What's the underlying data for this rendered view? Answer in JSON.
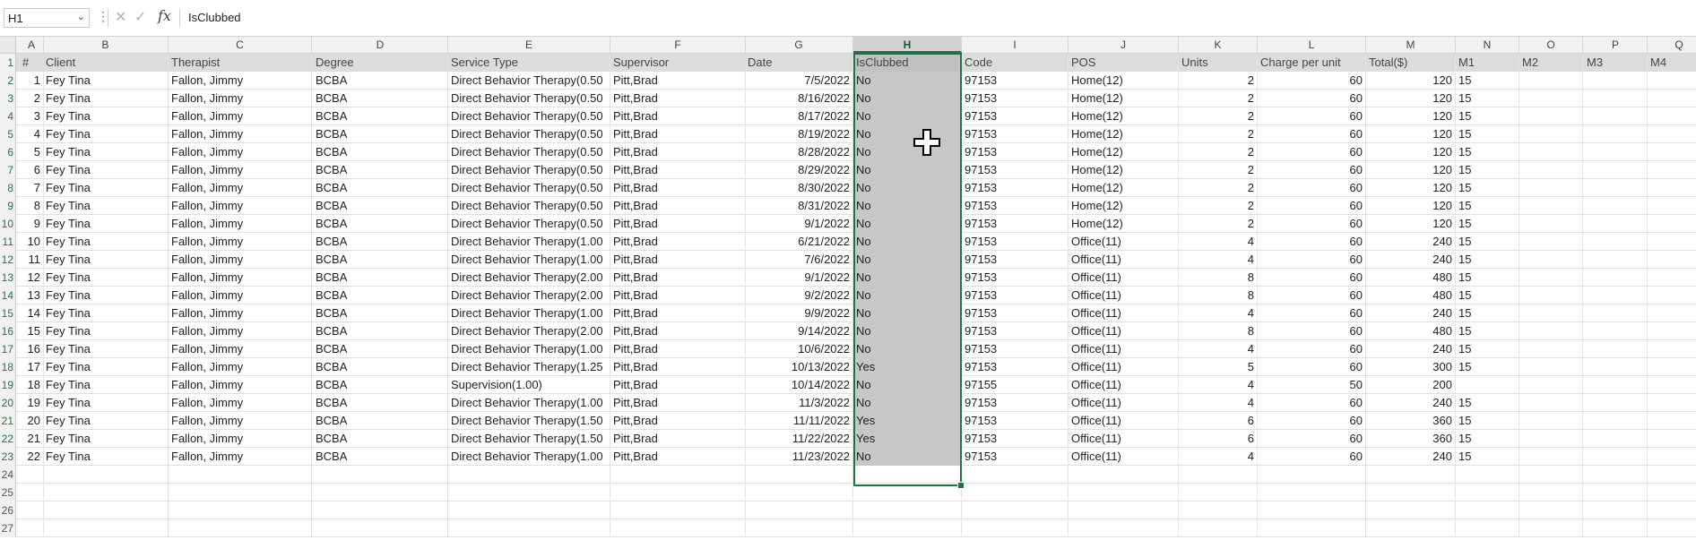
{
  "formula_bar": {
    "name_box": "H1",
    "content": "IsClubbed",
    "icons": [
      "more-icon",
      "cancel-icon",
      "enter-icon",
      "fx-icon"
    ]
  },
  "selected_column": "H",
  "columns": [
    "A",
    "B",
    "C",
    "D",
    "E",
    "F",
    "G",
    "H",
    "I",
    "J",
    "K",
    "L",
    "M",
    "N",
    "O",
    "P",
    "Q"
  ],
  "header": [
    "#",
    "Client",
    "Therapist",
    "Degree",
    "Service Type",
    "Supervisor",
    "Date",
    "IsClubbed",
    "Code",
    "POS",
    "Units",
    "Charge per unit",
    "Total($)",
    "M1",
    "M2",
    "M3",
    "M4"
  ],
  "rows": [
    [
      "1",
      "Fey Tina",
      "Fallon, Jimmy",
      "BCBA",
      "Direct Behavior Therapy(0.50",
      "Pitt,Brad",
      "7/5/2022",
      "No",
      "97153",
      "Home(12)",
      "2",
      "60",
      "120",
      "15"
    ],
    [
      "2",
      "Fey Tina",
      "Fallon, Jimmy",
      "BCBA",
      "Direct Behavior Therapy(0.50",
      "Pitt,Brad",
      "8/16/2022",
      "No",
      "97153",
      "Home(12)",
      "2",
      "60",
      "120",
      "15"
    ],
    [
      "3",
      "Fey Tina",
      "Fallon, Jimmy",
      "BCBA",
      "Direct Behavior Therapy(0.50",
      "Pitt,Brad",
      "8/17/2022",
      "No",
      "97153",
      "Home(12)",
      "2",
      "60",
      "120",
      "15"
    ],
    [
      "4",
      "Fey Tina",
      "Fallon, Jimmy",
      "BCBA",
      "Direct Behavior Therapy(0.50",
      "Pitt,Brad",
      "8/19/2022",
      "No",
      "97153",
      "Home(12)",
      "2",
      "60",
      "120",
      "15"
    ],
    [
      "5",
      "Fey Tina",
      "Fallon, Jimmy",
      "BCBA",
      "Direct Behavior Therapy(0.50",
      "Pitt,Brad",
      "8/28/2022",
      "No",
      "97153",
      "Home(12)",
      "2",
      "60",
      "120",
      "15"
    ],
    [
      "6",
      "Fey Tina",
      "Fallon, Jimmy",
      "BCBA",
      "Direct Behavior Therapy(0.50",
      "Pitt,Brad",
      "8/29/2022",
      "No",
      "97153",
      "Home(12)",
      "2",
      "60",
      "120",
      "15"
    ],
    [
      "7",
      "Fey Tina",
      "Fallon, Jimmy",
      "BCBA",
      "Direct Behavior Therapy(0.50",
      "Pitt,Brad",
      "8/30/2022",
      "No",
      "97153",
      "Home(12)",
      "2",
      "60",
      "120",
      "15"
    ],
    [
      "8",
      "Fey Tina",
      "Fallon, Jimmy",
      "BCBA",
      "Direct Behavior Therapy(0.50",
      "Pitt,Brad",
      "8/31/2022",
      "No",
      "97153",
      "Home(12)",
      "2",
      "60",
      "120",
      "15"
    ],
    [
      "9",
      "Fey Tina",
      "Fallon, Jimmy",
      "BCBA",
      "Direct Behavior Therapy(0.50",
      "Pitt,Brad",
      "9/1/2022",
      "No",
      "97153",
      "Home(12)",
      "2",
      "60",
      "120",
      "15"
    ],
    [
      "10",
      "Fey Tina",
      "Fallon, Jimmy",
      "BCBA",
      "Direct Behavior Therapy(1.00",
      "Pitt,Brad",
      "6/21/2022",
      "No",
      "97153",
      "Office(11)",
      "4",
      "60",
      "240",
      "15"
    ],
    [
      "11",
      "Fey Tina",
      "Fallon, Jimmy",
      "BCBA",
      "Direct Behavior Therapy(1.00",
      "Pitt,Brad",
      "7/6/2022",
      "No",
      "97153",
      "Office(11)",
      "4",
      "60",
      "240",
      "15"
    ],
    [
      "12",
      "Fey Tina",
      "Fallon, Jimmy",
      "BCBA",
      "Direct Behavior Therapy(2.00",
      "Pitt,Brad",
      "9/1/2022",
      "No",
      "97153",
      "Office(11)",
      "8",
      "60",
      "480",
      "15"
    ],
    [
      "13",
      "Fey Tina",
      "Fallon, Jimmy",
      "BCBA",
      "Direct Behavior Therapy(2.00",
      "Pitt,Brad",
      "9/2/2022",
      "No",
      "97153",
      "Office(11)",
      "8",
      "60",
      "480",
      "15"
    ],
    [
      "14",
      "Fey Tina",
      "Fallon, Jimmy",
      "BCBA",
      "Direct Behavior Therapy(1.00",
      "Pitt,Brad",
      "9/9/2022",
      "No",
      "97153",
      "Office(11)",
      "4",
      "60",
      "240",
      "15"
    ],
    [
      "15",
      "Fey Tina",
      "Fallon, Jimmy",
      "BCBA",
      "Direct Behavior Therapy(2.00",
      "Pitt,Brad",
      "9/14/2022",
      "No",
      "97153",
      "Office(11)",
      "8",
      "60",
      "480",
      "15"
    ],
    [
      "16",
      "Fey Tina",
      "Fallon, Jimmy",
      "BCBA",
      "Direct Behavior Therapy(1.00",
      "Pitt,Brad",
      "10/6/2022",
      "No",
      "97153",
      "Office(11)",
      "4",
      "60",
      "240",
      "15"
    ],
    [
      "17",
      "Fey Tina",
      "Fallon, Jimmy",
      "BCBA",
      "Direct Behavior Therapy(1.25",
      "Pitt,Brad",
      "10/13/2022",
      "Yes",
      "97153",
      "Office(11)",
      "5",
      "60",
      "300",
      "15"
    ],
    [
      "18",
      "Fey Tina",
      "Fallon, Jimmy",
      "BCBA",
      "Supervision(1.00)",
      "Pitt,Brad",
      "10/14/2022",
      "No",
      "97155",
      "Office(11)",
      "4",
      "50",
      "200",
      ""
    ],
    [
      "19",
      "Fey Tina",
      "Fallon, Jimmy",
      "BCBA",
      "Direct Behavior Therapy(1.00",
      "Pitt,Brad",
      "11/3/2022",
      "No",
      "97153",
      "Office(11)",
      "4",
      "60",
      "240",
      "15"
    ],
    [
      "20",
      "Fey Tina",
      "Fallon, Jimmy",
      "BCBA",
      "Direct Behavior Therapy(1.50",
      "Pitt,Brad",
      "11/11/2022",
      "Yes",
      "97153",
      "Office(11)",
      "6",
      "60",
      "360",
      "15"
    ],
    [
      "21",
      "Fey Tina",
      "Fallon, Jimmy",
      "BCBA",
      "Direct Behavior Therapy(1.50",
      "Pitt,Brad",
      "11/22/2022",
      "Yes",
      "97153",
      "Office(11)",
      "6",
      "60",
      "360",
      "15"
    ],
    [
      "22",
      "Fey Tina",
      "Fallon, Jimmy",
      "BCBA",
      "Direct Behavior Therapy(1.00",
      "Pitt,Brad",
      "11/23/2022",
      "No",
      "97153",
      "Office(11)",
      "4",
      "60",
      "240",
      "15"
    ]
  ],
  "empty_row_numbers": [
    "24",
    "25",
    "26",
    "27"
  ],
  "colors": {
    "accent": "#217346",
    "selection": "#c7c7c7",
    "header_row": "#dcdcdc"
  },
  "cursor": "move-cross-icon"
}
